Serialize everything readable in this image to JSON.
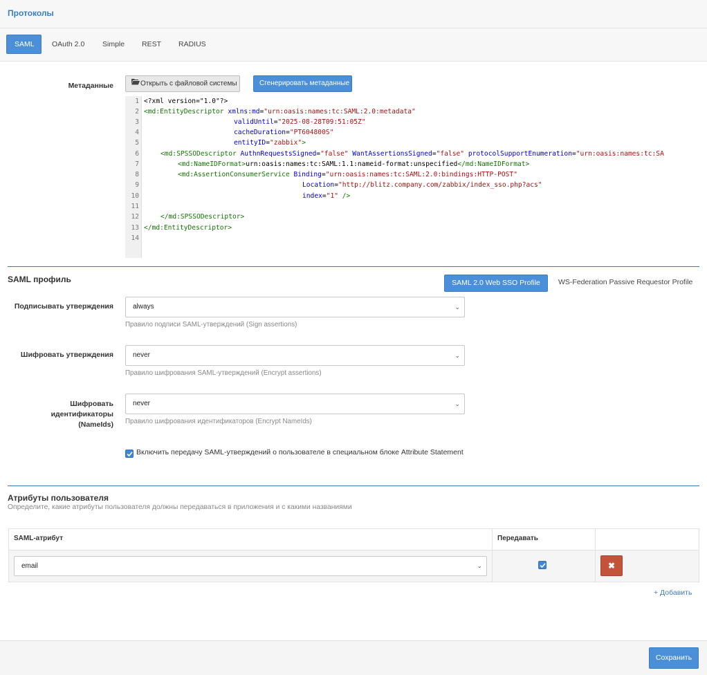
{
  "header": {
    "title": "Протоколы"
  },
  "tabs": [
    {
      "label": "SAML",
      "active": true
    },
    {
      "label": "OAuth 2.0"
    },
    {
      "label": "Simple"
    },
    {
      "label": "REST"
    },
    {
      "label": "RADIUS"
    }
  ],
  "metadata": {
    "label": "Метаданные",
    "open_button": "Открыть с файловой системы",
    "open_icon": "folder-open-icon",
    "generate_button": "Сгенерировать метаданные",
    "line_numbers": [
      "1",
      "2",
      "3",
      "4",
      "5",
      "6",
      "7",
      "8",
      "9",
      "10",
      "11",
      "12",
      "13",
      "14"
    ],
    "code": {
      "l1": "<?xml version=\"1.0\"?>",
      "l2_tag": "<md:EntityDescriptor",
      "l2_attr": "xmlns:md",
      "l2_str": "\"urn:oasis:names:tc:SAML:2.0:metadata\"",
      "l3_attr": "validUntil",
      "l3_str": "\"2025-08-28T09:51:05Z\"",
      "l4_attr": "cacheDuration",
      "l4_str": "\"PT604800S\"",
      "l5_attr": "entityID",
      "l5_str": "\"zabbix\"",
      "l5_end": ">",
      "l6_tag": "<md:SPSSODescriptor",
      "l6_attr1": "AuthnRequestsSigned",
      "l6_str1": "\"false\"",
      "l6_attr2": "WantAssertionsSigned",
      "l6_str2": "\"false\"",
      "l6_attr3": "protocolSupportEnumeration",
      "l6_str3": "\"urn:oasis:names:tc:SA",
      "l7_tag": "<md:NameIDFormat>",
      "l7_text": "urn:oasis:names:tc:SAML:1.1:nameid-format:unspecified",
      "l7_end": "</md:NameIDFormat>",
      "l8_tag": "<md:AssertionConsumerService",
      "l8_attr": "Binding",
      "l8_str": "\"urn:oasis:names:tc:SAML:2.0:bindings:HTTP-POST\"",
      "l9_attr": "Location",
      "l9_str": "\"http://blitz.company.com/zabbix/index_sso.php?acs\"",
      "l10_attr": "index",
      "l10_str": "\"1\"",
      "l10_end": " />",
      "l12": "</md:SPSSODescriptor>",
      "l13": "</md:EntityDescriptor>"
    }
  },
  "saml_profile": {
    "title": "SAML профиль",
    "profile_active": "SAML 2.0 Web SSO Profile",
    "profile_other": "WS-Federation Passive Requestor Profile",
    "sign": {
      "label": "Подписывать утверждения",
      "value": "always",
      "help": "Правило подписи SAML-утверждений (Sign assertions)"
    },
    "encrypt": {
      "label": "Шифровать утверждения",
      "value": "never",
      "help": "Правило шифрования SAML-утверждений (Encrypt assertions)"
    },
    "encrypt_ids": {
      "label_line1": "Шифровать идентификаторы",
      "label_line2": "(NameIds)",
      "value": "never",
      "help": "Правило шифрования идентификаторов (Encrypt NameIds)"
    },
    "attr_statement": {
      "checked": true,
      "label": "Включить передачу SAML-утверждений о пользователе в специальном блоке Attribute Statement"
    }
  },
  "attributes": {
    "title": "Атрибуты пользователя",
    "subtitle": "Определите, какие атрибуты пользователя должны передаваться в приложения и с какими названиями",
    "col_attr": "SAML-атрибут",
    "col_send": "Передавать",
    "rows": [
      {
        "attr": "email",
        "send": true
      }
    ],
    "add_link": "+ Добавить"
  },
  "footer": {
    "save": "Сохранить"
  },
  "colors": {
    "accent": "#4a8fd8",
    "danger": "#c4533c",
    "tag": "#117700",
    "attr": "#0000cc",
    "str": "#aa1111"
  }
}
